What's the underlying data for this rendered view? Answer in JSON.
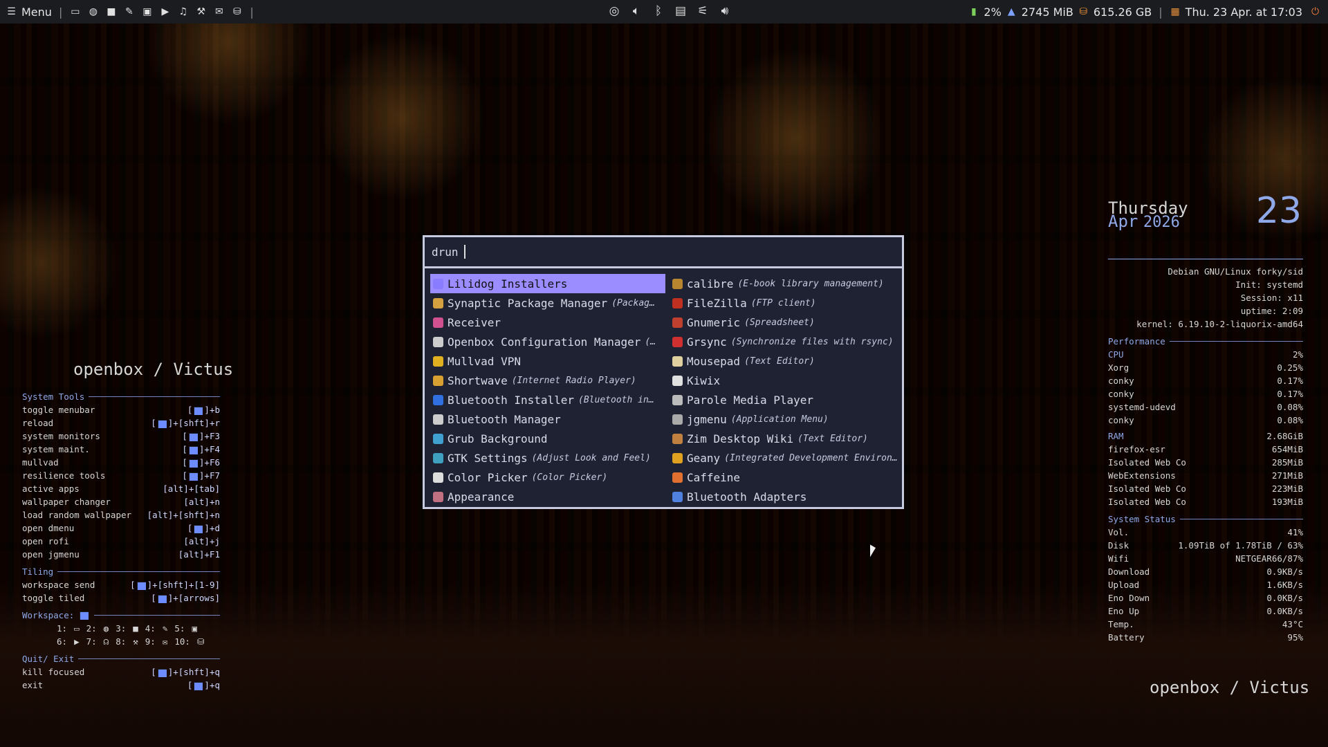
{
  "panel": {
    "menu_label": "Menu",
    "launchers": [
      "terminal-icon",
      "globe-icon",
      "folder-icon",
      "edit-icon",
      "image-icon",
      "video-icon",
      "music-icon",
      "wrench-icon",
      "mail-icon",
      "archive-icon"
    ],
    "status": {
      "cpu": "2%",
      "mem": "2745 MiB",
      "disk": "615.26 GB",
      "datetime": "Thu. 23 Apr. at 17:03"
    }
  },
  "rofi": {
    "prompt": "drun",
    "items": [
      {
        "name": "Lilidog Installers",
        "desc": "",
        "color": "#8a7cff",
        "selected": true
      },
      {
        "name": "calibre",
        "desc": "(E-book library management)",
        "color": "#b8862e"
      },
      {
        "name": "Synaptic Package Manager",
        "desc": "(Packag…",
        "color": "#d4a040"
      },
      {
        "name": "FileZilla",
        "desc": "(FTP client)",
        "color": "#c03020"
      },
      {
        "name": "Receiver",
        "desc": "",
        "color": "#d05090"
      },
      {
        "name": "Gnumeric",
        "desc": "(Spreadsheet)",
        "color": "#c04030"
      },
      {
        "name": "Openbox Configuration Manager",
        "desc": "(…",
        "color": "#cccccc"
      },
      {
        "name": "Grsync",
        "desc": "(Synchronize files with rsync)",
        "color": "#d03030"
      },
      {
        "name": "Mullvad VPN",
        "desc": "",
        "color": "#e0b020"
      },
      {
        "name": "Mousepad",
        "desc": "(Text Editor)",
        "color": "#e0d0a0"
      },
      {
        "name": "Shortwave",
        "desc": "(Internet Radio Player)",
        "color": "#d8a030"
      },
      {
        "name": "Kiwix",
        "desc": "",
        "color": "#e0e0e0"
      },
      {
        "name": "Bluetooth Installer",
        "desc": "(Bluetooth in…",
        "color": "#3070e0"
      },
      {
        "name": "Parole Media Player",
        "desc": "",
        "color": "#bbbbbb"
      },
      {
        "name": "Bluetooth Manager",
        "desc": "",
        "color": "#cccccc"
      },
      {
        "name": "jgmenu",
        "desc": "(Application Menu)",
        "color": "#aaaaaa"
      },
      {
        "name": "Grub Background",
        "desc": "",
        "color": "#40a0d0"
      },
      {
        "name": "Zim Desktop Wiki",
        "desc": "(Text Editor)",
        "color": "#c08040"
      },
      {
        "name": "GTK Settings",
        "desc": "(Adjust Look and Feel)",
        "color": "#40a0c0"
      },
      {
        "name": "Geany",
        "desc": "(Integrated Development Environ…",
        "color": "#e0a020"
      },
      {
        "name": "Color Picker",
        "desc": "(Color Picker)",
        "color": "#dddddd"
      },
      {
        "name": "Caffeine",
        "desc": "",
        "color": "#e07030"
      },
      {
        "name": "Appearance",
        "desc": "",
        "color": "#c07080"
      },
      {
        "name": "Bluetooth Adapters",
        "desc": "",
        "color": "#5080e0"
      }
    ]
  },
  "left": {
    "title": "openbox / Victus",
    "system_tools_label": "System Tools",
    "system_tools": [
      {
        "label": "toggle menubar",
        "keys": "]+b"
      },
      {
        "label": "reload",
        "keys": "]+[shft]+r"
      },
      {
        "label": "system monitors",
        "keys": "]+F3"
      },
      {
        "label": "system maint.",
        "keys": "]+F4"
      },
      {
        "label": "mullvad",
        "keys": "]+F6"
      },
      {
        "label": "resilience tools",
        "keys": "]+F7"
      },
      {
        "label": "active apps",
        "keys": "[alt]+[tab]"
      },
      {
        "label": "wallpaper changer",
        "keys": "[alt]+n"
      },
      {
        "label": "load random wallpaper",
        "keys": "[alt]+[shft]+n"
      },
      {
        "label": "open dmenu",
        "keys": "]+d"
      },
      {
        "label": "open rofi",
        "keys": "[alt]+j"
      },
      {
        "label": "open jgmenu",
        "keys": "[alt]+F1"
      }
    ],
    "tiling_label": "Tiling",
    "tiling": [
      {
        "label": "workspace send",
        "keys": "]+[shft]+[1-9]"
      },
      {
        "label": "toggle tiled",
        "keys": "]+[arrows]"
      }
    ],
    "workspace_label": "Workspace:",
    "workspaces_row1": [
      "1:",
      "2:",
      "3:",
      "4:",
      "5:"
    ],
    "workspaces_row2": [
      "6:",
      "7:",
      "8:",
      "9:",
      "10:"
    ],
    "quit_label": "Quit/ Exit",
    "quit": [
      {
        "label": "kill focused",
        "keys": "]+[shft]+q"
      },
      {
        "label": "exit",
        "keys": "]+q"
      }
    ]
  },
  "right": {
    "day": "Thursday",
    "month": "Apr",
    "year": "2026",
    "date": "23",
    "sysinfo": [
      "Debian GNU/Linux forky/sid",
      "Init: systemd",
      "Session: x11",
      "uptime: 2:09",
      "kernel: 6.19.10-2-liquorix-amd64"
    ],
    "performance_label": "Performance",
    "cpu_label": "CPU",
    "cpu_value": "2%",
    "cpu_procs": [
      {
        "name": "Xorg",
        "value": "0.25%"
      },
      {
        "name": "conky",
        "value": "0.17%"
      },
      {
        "name": "conky",
        "value": "0.17%"
      },
      {
        "name": "systemd-udevd",
        "value": "0.08%"
      },
      {
        "name": "conky",
        "value": "0.08%"
      }
    ],
    "ram_label": "RAM",
    "ram_value": "2.68GiB",
    "ram_procs": [
      {
        "name": "firefox-esr",
        "value": "654MiB"
      },
      {
        "name": "Isolated Web Co",
        "value": "285MiB"
      },
      {
        "name": "WebExtensions",
        "value": "271MiB"
      },
      {
        "name": "Isolated Web Co",
        "value": "223MiB"
      },
      {
        "name": "Isolated Web Co",
        "value": "193MiB"
      }
    ],
    "status_label": "System Status",
    "status": [
      {
        "name": "Vol.",
        "value": "41%"
      },
      {
        "name": "Disk",
        "value": "1.09TiB of 1.78TiB / 63%"
      },
      {
        "name": "Wifi",
        "value": "NETGEAR66/87%"
      },
      {
        "name": "Download",
        "value": "0.9KB/s"
      },
      {
        "name": "Upload",
        "value": "1.6KB/s"
      },
      {
        "name": "Eno Down",
        "value": "0.0KB/s"
      },
      {
        "name": "Eno Up",
        "value": "0.0KB/s"
      },
      {
        "name": "Temp.",
        "value": "43°C"
      },
      {
        "name": "Battery",
        "value": "95%"
      }
    ],
    "bottom_title": "openbox  / Victus"
  }
}
